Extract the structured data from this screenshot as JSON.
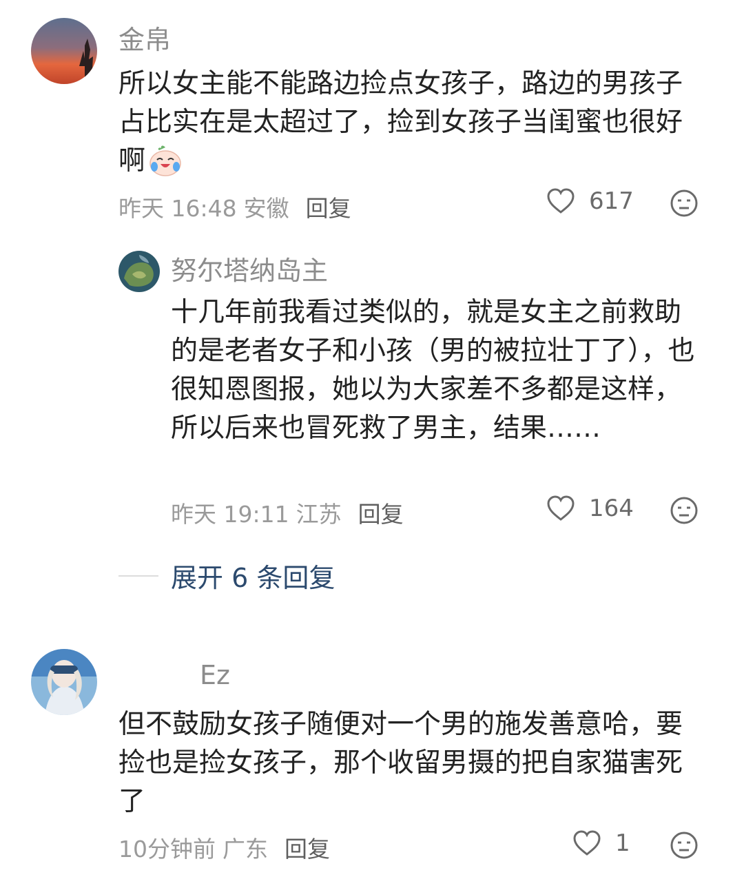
{
  "comments": [
    {
      "username": "金帛",
      "text": "所以女主能不能路边捡点女孩子，路边的男孩子占比实在是太超过了，捡到女孩子当闺蜜也很好啊",
      "emoji": "crying-laughing-peach-emoji",
      "time": "昨天 16:48",
      "location": "安徽",
      "reply_label": "回复",
      "likes": "617",
      "reply": {
        "username": "努尔塔纳岛主",
        "text": "十几年前我看过类似的，就是女主之前救助的是老者女子和小孩（男的被拉壮丁了），也很知恩图报，她以为大家差不多都是这样，所以后来也冒死救了男主，结果……",
        "time": "昨天 19:11",
        "location": "江苏",
        "reply_label": "回复",
        "likes": "164"
      },
      "expand_label": "展开 6 条回复"
    },
    {
      "username": "Ez",
      "text": "但不鼓励女孩子随便对一个男的施发善意哈，要捡也是捡女孩子，那个收留男摄的把自家猫害死了",
      "time": "10分钟前",
      "location": "广东",
      "reply_label": "回复",
      "likes": "1"
    }
  ],
  "icons": {
    "like": "heart-outline-icon",
    "dislike": "neutral-face-icon"
  },
  "colors": {
    "username": "#8c8c8c",
    "meta": "#9a9a9a",
    "expand": "#2c4a6e"
  }
}
